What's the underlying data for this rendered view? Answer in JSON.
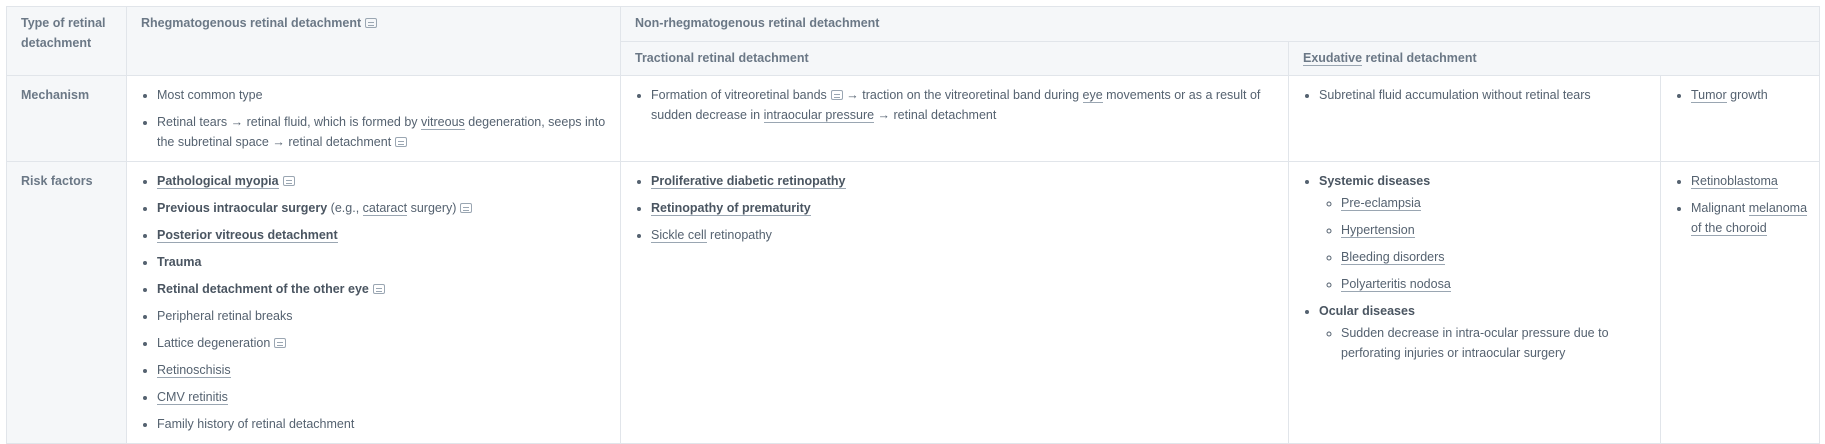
{
  "header": {
    "type_label": "Type of retinal detachment",
    "rhegmatogenous": "Rhegmatogenous retinal detachment",
    "non_rhegmatogenous": "Non-rhegmatogenous retinal detachment",
    "tractional": "Tractional retinal detachment",
    "exudative_a": "Exudative",
    "exudative_b": " retinal detachment"
  },
  "mechanism": {
    "label": "Mechanism",
    "rheg_1": "Most common type",
    "rheg_2_a": "Retinal tears → retinal fluid, which is formed by ",
    "rheg_2_link": "vitreous",
    "rheg_2_b": " degeneration, seeps into the subretinal space → retinal detachment",
    "tract_a": "Formation of vitreoretinal bands",
    "tract_b": " → traction on the vitreoretinal band during ",
    "tract_link1": "eye",
    "tract_c": " movements or as a result of sudden decrease in ",
    "tract_link2": "intraocular pressure",
    "tract_d": " → retinal detachment",
    "exud": "Subretinal fluid accumulation without retinal tears",
    "tumor_link": "Tumor",
    "tumor_rest": " growth"
  },
  "risk": {
    "label": "Risk factors",
    "rheg": {
      "r1": "Pathological myopia",
      "r2_bold": "Previous intraocular surgery",
      "r2_a": " (e.g., ",
      "r2_link": "cataract",
      "r2_b": " surgery)",
      "r3": "Posterior vitreous detachment",
      "r4": "Trauma",
      "r5": "Retinal detachment of the other eye",
      "r6": "Peripheral retinal breaks",
      "r7": "Lattice degeneration",
      "r8": "Retinoschisis",
      "r9": "CMV retinitis",
      "r10": "Family history of retinal detachment"
    },
    "tract": {
      "t1": "Proliferative diabetic retinopathy",
      "t2": "Retinopathy of prematurity",
      "t3_link": "Sickle cell",
      "t3_rest": " retinopathy"
    },
    "exud": {
      "systemic": "Systemic diseases",
      "s1": "Pre-eclampsia",
      "s2": "Hypertension",
      "s3": "Bleeding disorders",
      "s4": "Polyarteritis nodosa",
      "ocular": "Ocular diseases",
      "o1": "Sudden decrease in intra-ocular pressure due to perforating injuries or intraocular surgery"
    },
    "tumor": {
      "m1": "Retinoblastoma",
      "m2_a": "Malignant ",
      "m2_link": "melanoma of the choroid"
    }
  }
}
